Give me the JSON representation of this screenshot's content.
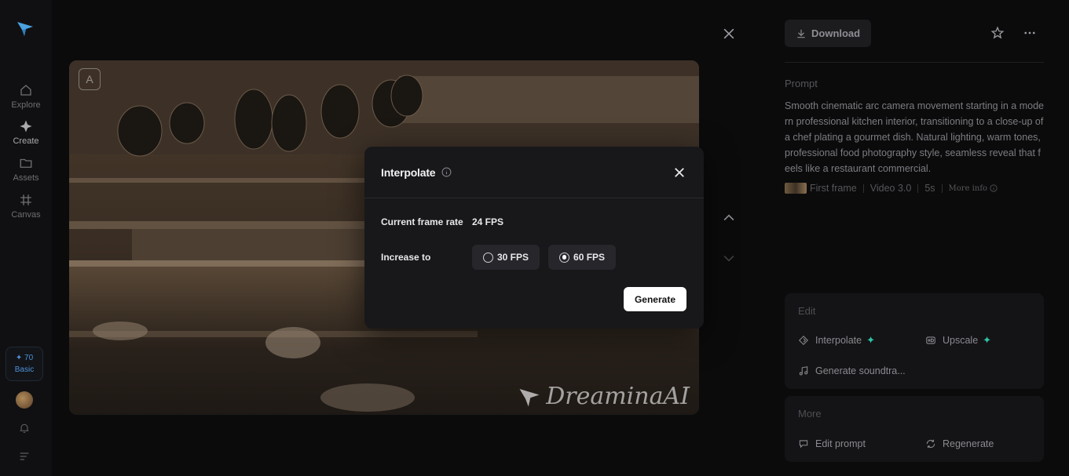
{
  "rail": {
    "nav": [
      {
        "label": "Explore",
        "icon": "home-icon"
      },
      {
        "label": "Create",
        "icon": "sparkle-diamond-icon"
      },
      {
        "label": "Assets",
        "icon": "folder-icon"
      },
      {
        "label": "Canvas",
        "icon": "canvas-grid-icon"
      }
    ],
    "credits_value": "✦ 70",
    "credits_plan": "Basic"
  },
  "video": {
    "badge": "A",
    "watermark": "DreaminaAI"
  },
  "modal": {
    "title": "Interpolate",
    "current_rate_label": "Current frame rate",
    "current_rate_value": "24 FPS",
    "increase_label": "Increase to",
    "options": [
      {
        "label": "30 FPS",
        "selected": false
      },
      {
        "label": "60 FPS",
        "selected": true
      }
    ],
    "generate_label": "Generate"
  },
  "panel": {
    "download_label": "Download",
    "prompt_heading": "Prompt",
    "prompt_text": "Smooth cinematic arc camera movement starting in a modern professional kitchen interior, transitioning to a close-up of a chef plating a gourmet dish. Natural lighting, warm tones, professional food photography style, seamless reveal that feels like a restaurant commercial.",
    "meta": {
      "first_frame": "First frame",
      "model": "Video 3.0",
      "duration": "5s",
      "more_info": "More info"
    },
    "edit": {
      "heading": "Edit",
      "interpolate": "Interpolate",
      "upscale": "Upscale",
      "soundtrack": "Generate soundtra..."
    },
    "more": {
      "heading": "More",
      "edit_prompt": "Edit prompt",
      "regenerate": "Regenerate"
    }
  },
  "colors": {
    "accent_spark": "#2ec4a6",
    "credits_blue": "#4f8fd8",
    "modal_bg": "#18181b"
  }
}
